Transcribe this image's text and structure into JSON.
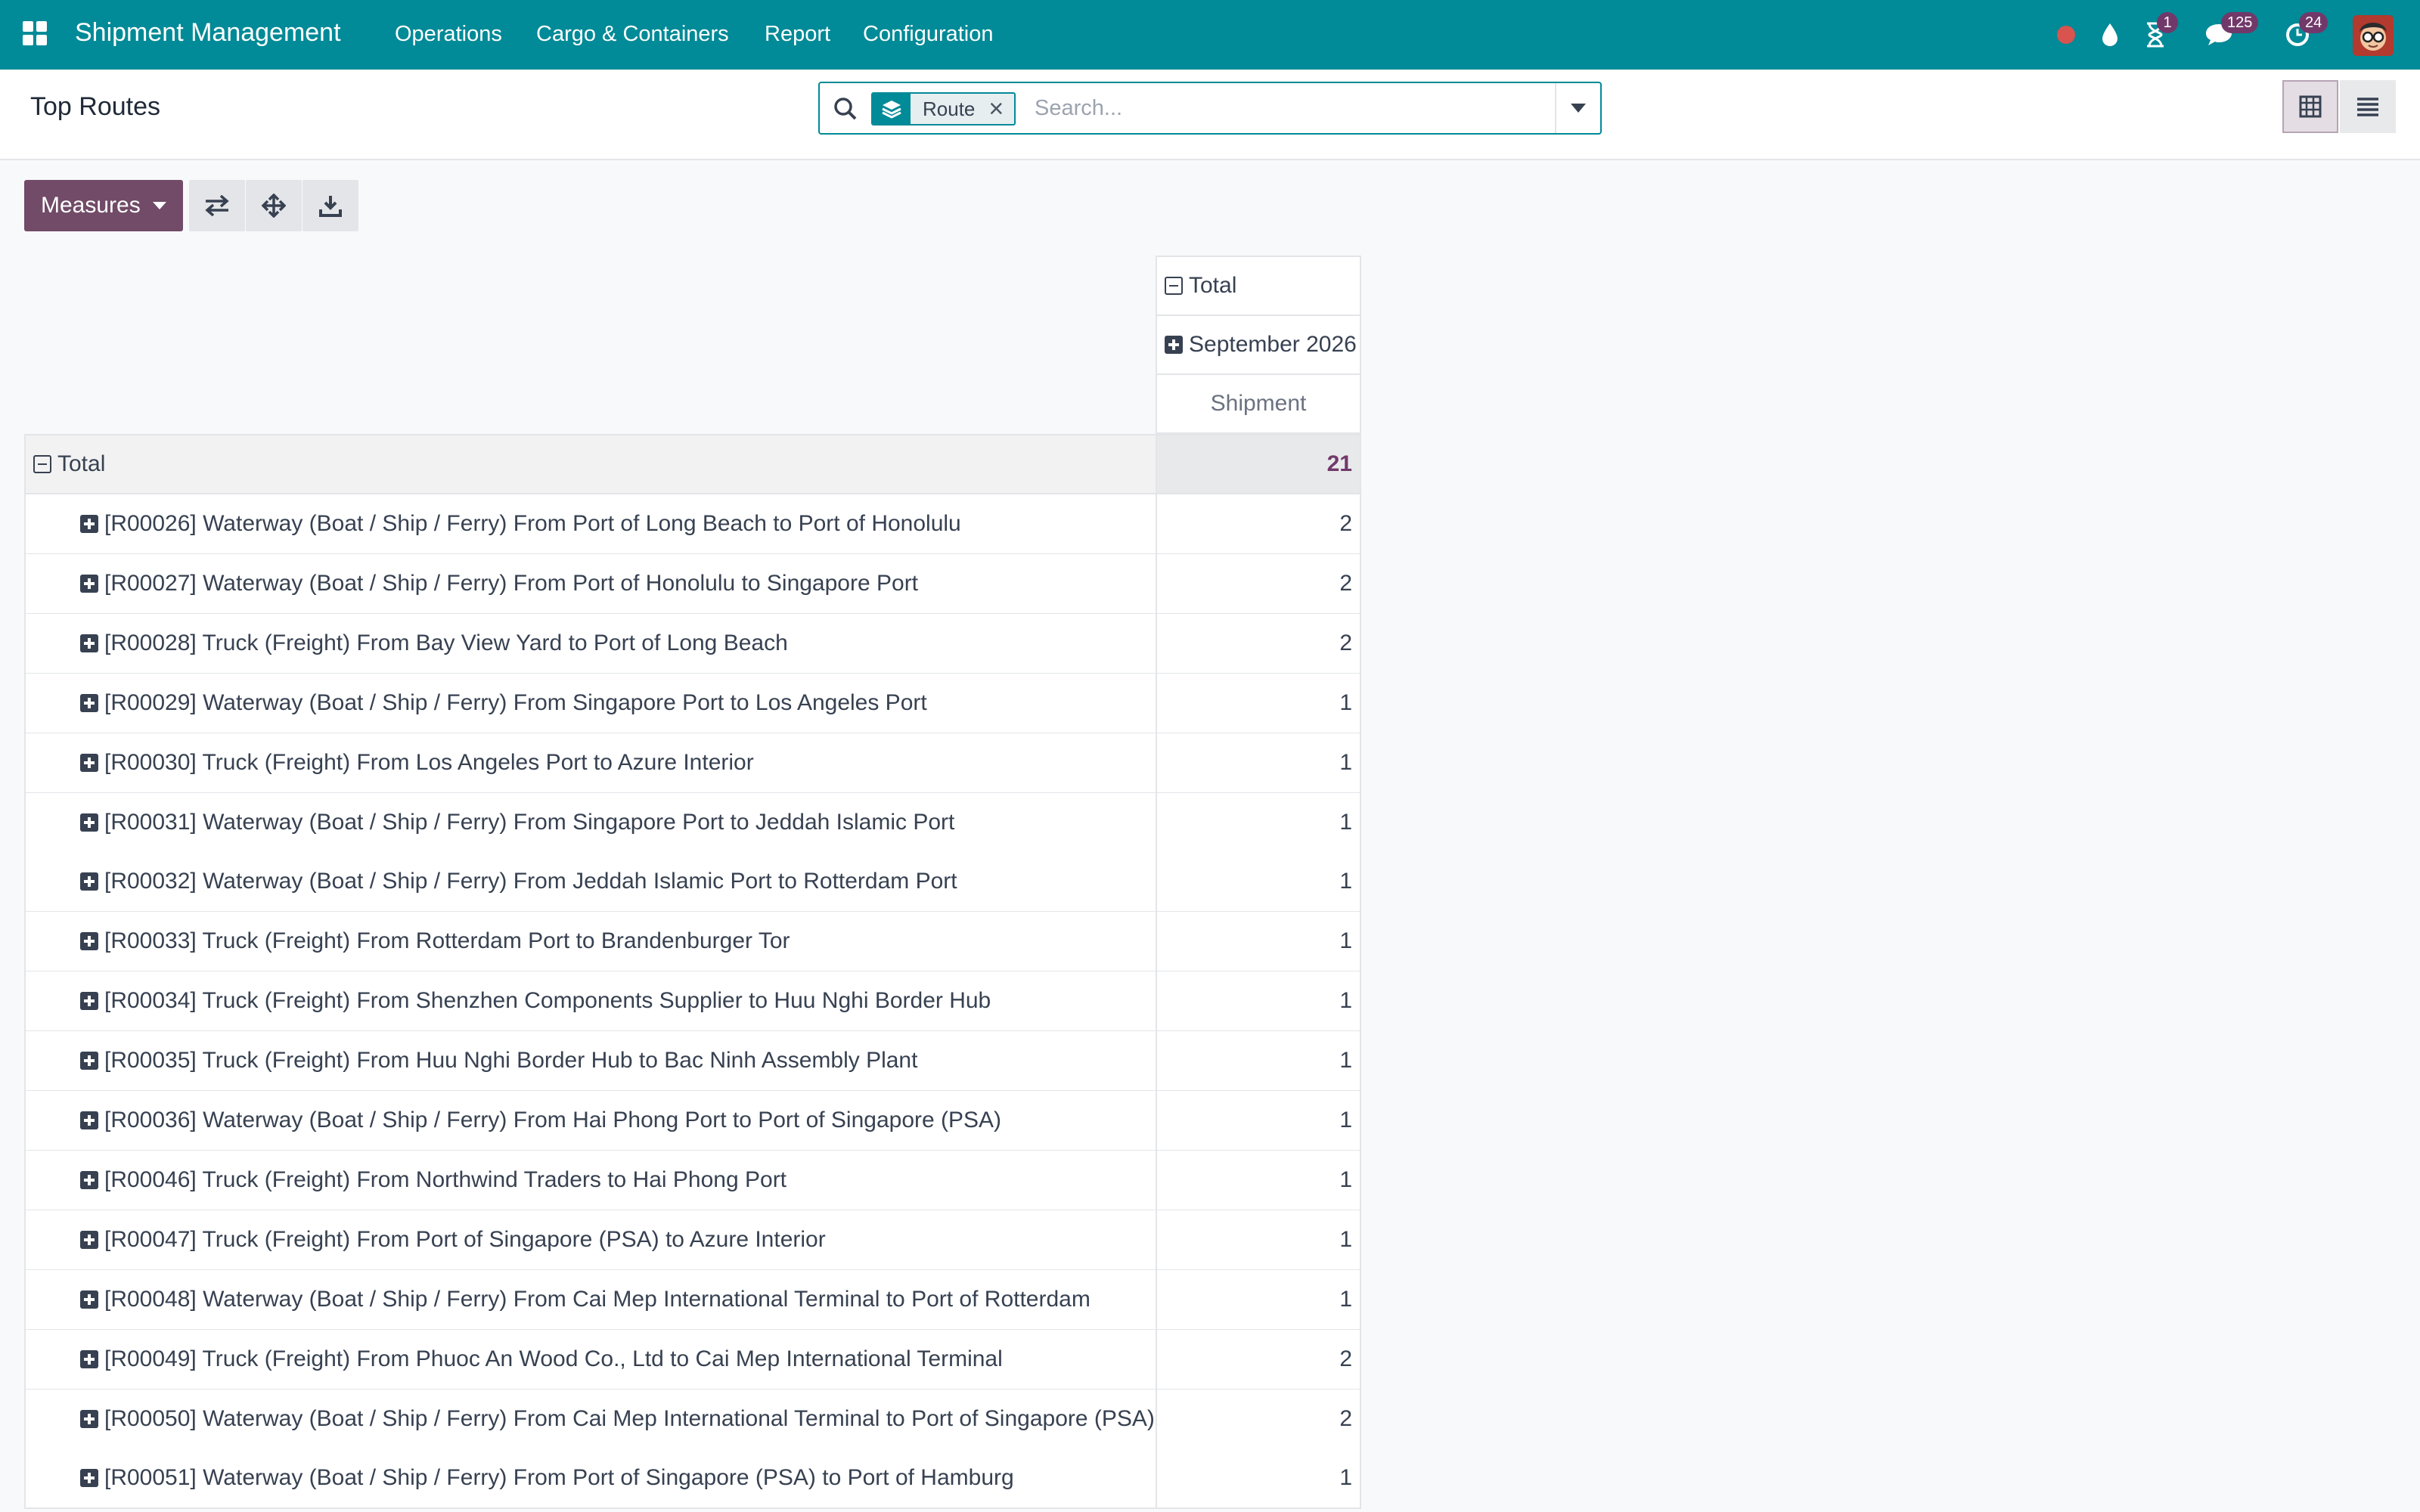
{
  "navbar": {
    "brand": "Shipment Management",
    "menu": [
      "Operations",
      "Cargo & Containers",
      "Report",
      "Configuration"
    ],
    "badges": {
      "activities": "1",
      "messages": "125",
      "updates": "24"
    }
  },
  "control_panel": {
    "title": "Top Routes",
    "search": {
      "facet_label": "Route",
      "placeholder": "Search..."
    }
  },
  "toolbar": {
    "measures_label": "Measures"
  },
  "pivot": {
    "col_total": "Total",
    "col_group": "September 2026",
    "measure": "Shipment",
    "row_total_label": "Total",
    "row_total_value": "21",
    "rows": [
      {
        "label": "[R00026] Waterway (Boat / Ship / Ferry) From Port of Long Beach to Port of Honolulu",
        "value": "2"
      },
      {
        "label": "[R00027] Waterway (Boat / Ship / Ferry) From Port of Honolulu to Singapore Port",
        "value": "2"
      },
      {
        "label": "[R00028] Truck (Freight) From Bay View Yard to Port of Long Beach",
        "value": "2"
      },
      {
        "label": "[R00029] Waterway (Boat / Ship / Ferry) From Singapore Port to Los Angeles Port",
        "value": "1"
      },
      {
        "label": "[R00030] Truck (Freight) From Los Angeles Port to Azure Interior",
        "value": "1"
      },
      {
        "label": "[R00031] Waterway (Boat / Ship / Ferry) From Singapore Port to Jeddah Islamic Port",
        "value": "1"
      },
      {
        "label": "[R00032] Waterway (Boat / Ship / Ferry) From Jeddah Islamic Port to Rotterdam Port",
        "value": "1"
      },
      {
        "label": "[R00033] Truck (Freight) From Rotterdam Port to Brandenburger Tor",
        "value": "1"
      },
      {
        "label": "[R00034] Truck (Freight) From Shenzhen Components Supplier to Huu Nghi Border Hub",
        "value": "1"
      },
      {
        "label": "[R00035] Truck (Freight) From Huu Nghi Border Hub to Bac Ninh Assembly Plant",
        "value": "1"
      },
      {
        "label": "[R00036] Waterway (Boat / Ship / Ferry) From Hai Phong Port to Port of Singapore (PSA)",
        "value": "1"
      },
      {
        "label": "[R00046] Truck (Freight) From Northwind Traders to Hai Phong Port",
        "value": "1"
      },
      {
        "label": "[R00047] Truck (Freight) From Port of Singapore (PSA) to Azure Interior",
        "value": "1"
      },
      {
        "label": "[R00048] Waterway (Boat / Ship / Ferry) From Cai Mep International Terminal to Port of Rotterdam",
        "value": "1"
      },
      {
        "label": "[R00049] Truck (Freight) From Phuoc An Wood Co., Ltd to Cai Mep International Terminal",
        "value": "2"
      },
      {
        "label": "[R00050] Waterway (Boat / Ship / Ferry) From Cai Mep International Terminal to Port of Singapore (PSA)",
        "value": "2"
      },
      {
        "label": "[R00051] Waterway (Boat / Ship / Ferry) From Port of Singapore (PSA) to Port of Hamburg",
        "value": "1"
      }
    ]
  }
}
